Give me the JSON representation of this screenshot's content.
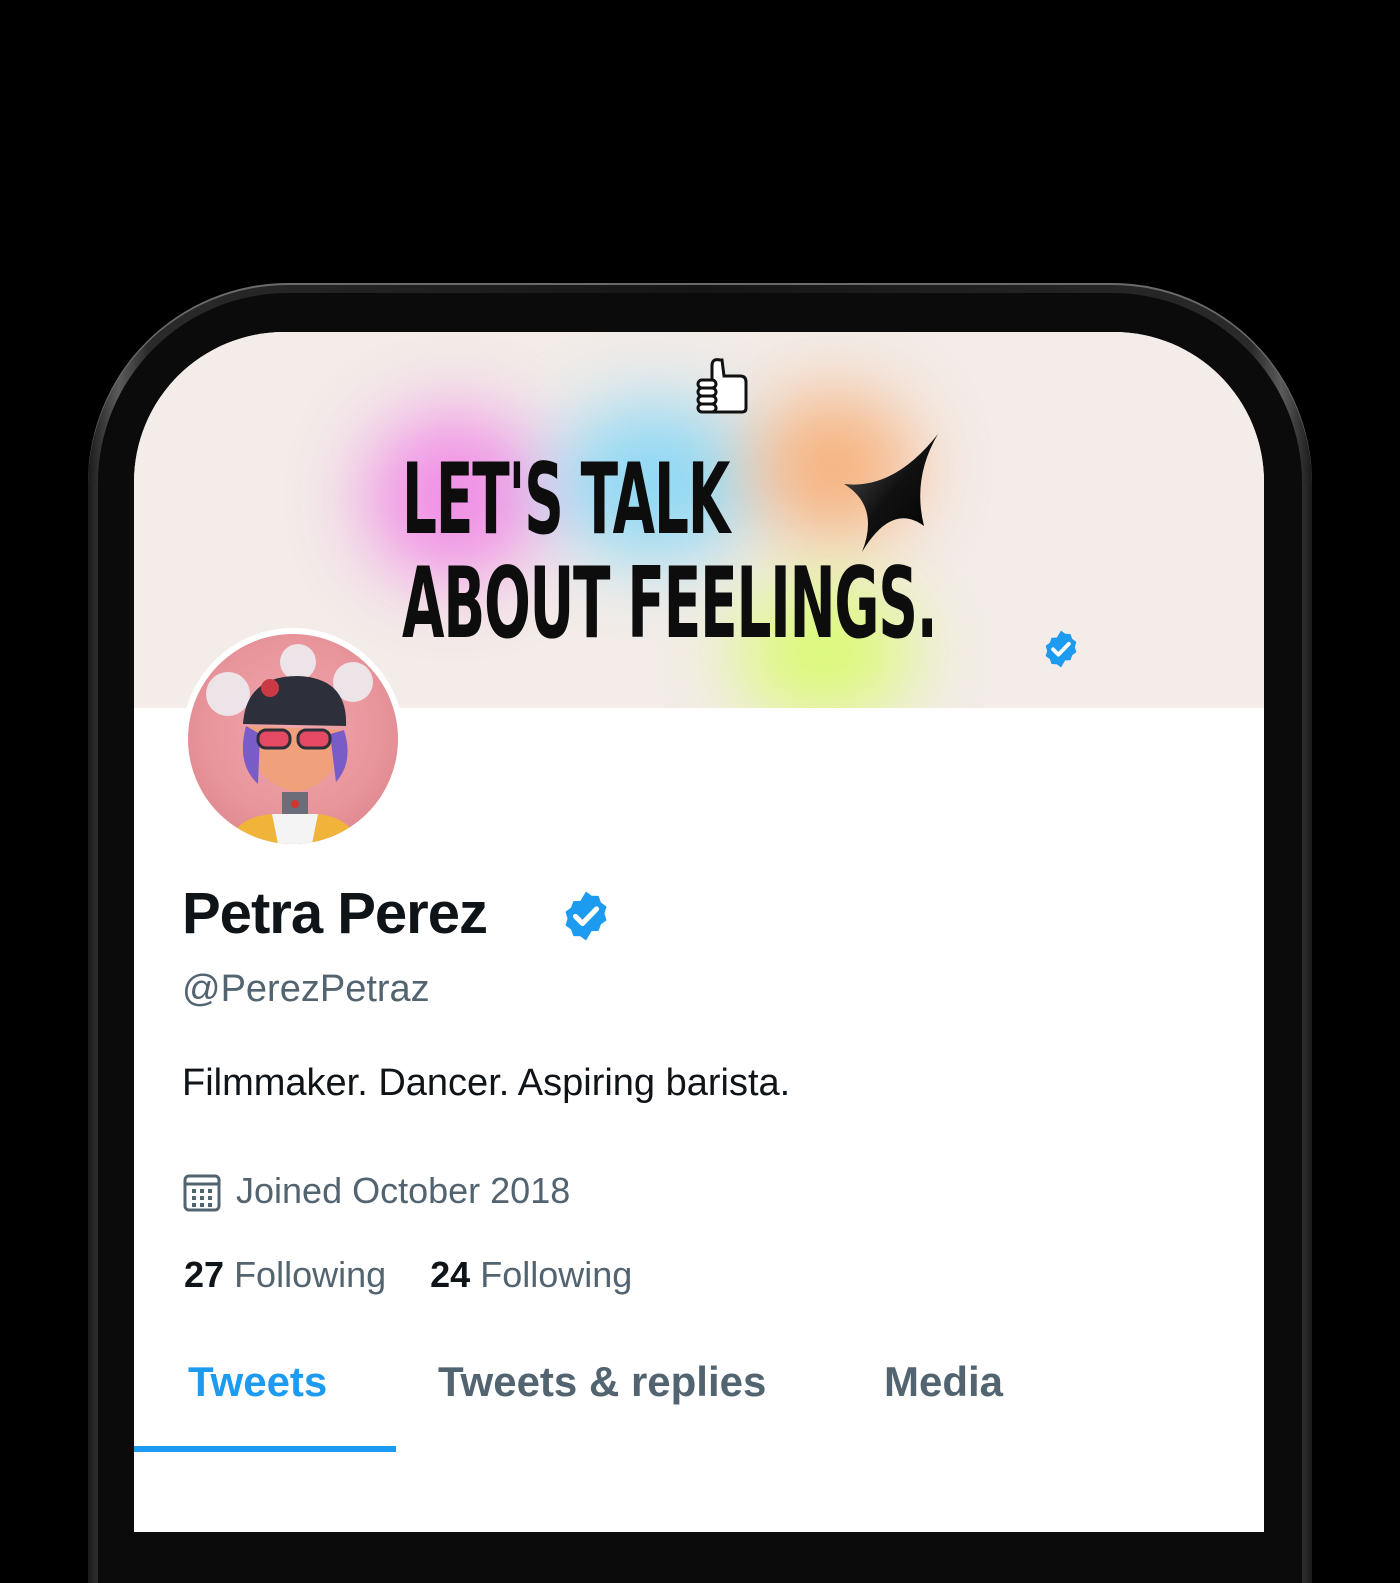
{
  "colors": {
    "background": "#000000",
    "accent": "#1d9bf0",
    "text_primary": "#0f1419",
    "text_secondary": "#536471",
    "banner_bg": "#f3ece8"
  },
  "banner": {
    "line1": "LET'S TALK",
    "line2": "ABOUT FEELINGS.",
    "icons": [
      "thumbs-up-icon",
      "sparkle-star-icon",
      "verified-badge-icon"
    ]
  },
  "profile": {
    "name": "Petra Perez",
    "handle": "@PerezPetraz",
    "bio": "Filmmaker. Dancer. Aspiring barista.",
    "joined": "Joined October 2018",
    "stats": [
      {
        "count": "27",
        "label": "Following"
      },
      {
        "count": "24",
        "label": "Following"
      }
    ]
  },
  "tabs": [
    {
      "label": "Tweets",
      "active": true
    },
    {
      "label": "Tweets & replies",
      "active": false
    },
    {
      "label": "Media",
      "active": false
    }
  ]
}
